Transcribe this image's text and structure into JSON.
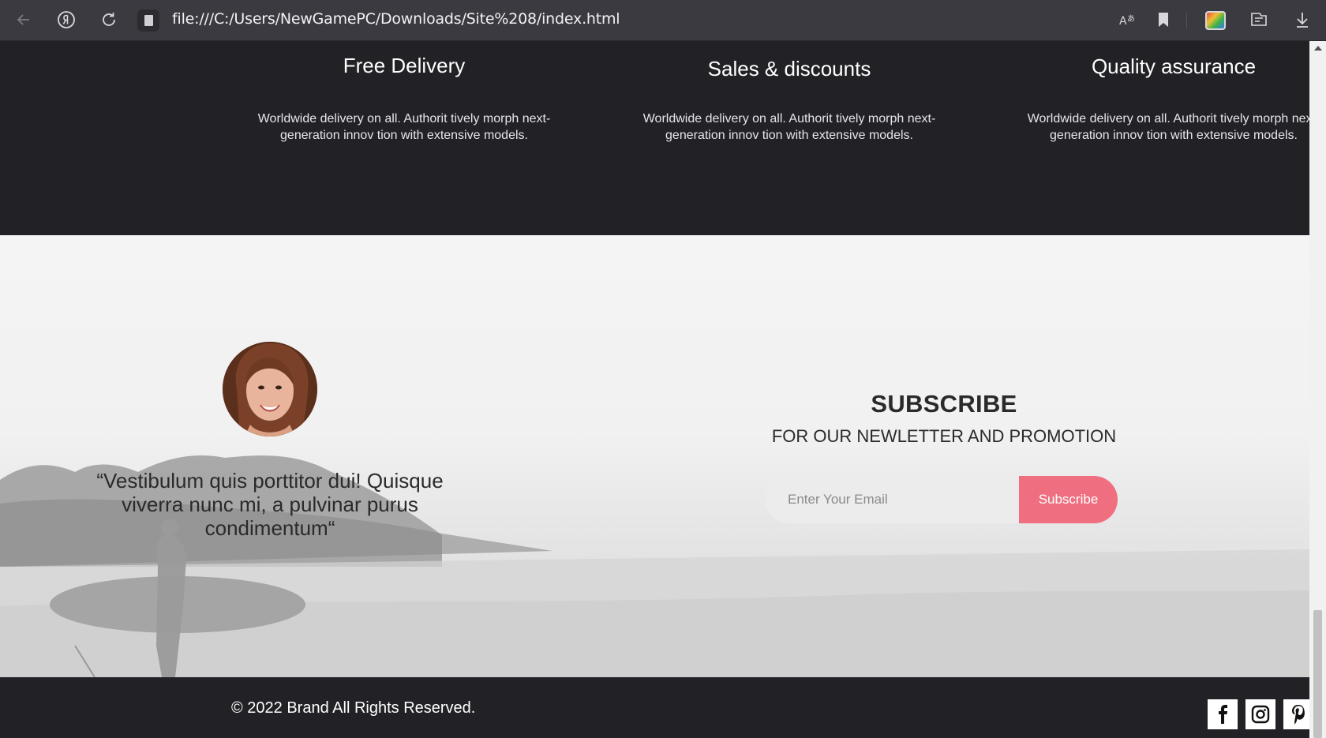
{
  "browser": {
    "url": "file:///C:/Users/NewGamePC/Downloads/Site%208/index.html",
    "icons": {
      "back": "back-arrow-icon",
      "yandex": "yandex-icon",
      "reload": "reload-icon",
      "file": "file-icon",
      "translate": "translate-icon",
      "bookmark": "bookmark-icon",
      "extension": "extension-icon",
      "collections": "collections-icon",
      "download": "download-icon"
    }
  },
  "features": [
    {
      "title": "Free Delivery",
      "text": "Worldwide delivery on all. Authorit tively morph next-generation innov tion with extensive models."
    },
    {
      "title": "Sales & discounts",
      "text": "Worldwide delivery on all. Authorit tively morph next-generation innov tion with extensive models."
    },
    {
      "title": "Quality assurance",
      "text": "Worldwide delivery on all. Authorit tively morph next-generation innov tion with extensive models."
    }
  ],
  "testimonial": {
    "quote": "“Vestibulum quis porttitor dui! Quisque viverra nunc mi, a pulvinar purus condimentum“"
  },
  "subscribe": {
    "title": "SUBSCRIBE",
    "subtitle": "FOR OUR NEWLETTER AND PROMOTION",
    "placeholder": "Enter Your Email",
    "button_label": "Subscribe",
    "button_color": "#ef6f80"
  },
  "footer": {
    "copyright": "© 2022 Brand All Rights Reserved.",
    "social": [
      {
        "name": "facebook-icon",
        "glyph": "f"
      },
      {
        "name": "instagram-icon",
        "glyph": ""
      },
      {
        "name": "pinterest-icon",
        "glyph": "P"
      }
    ]
  }
}
